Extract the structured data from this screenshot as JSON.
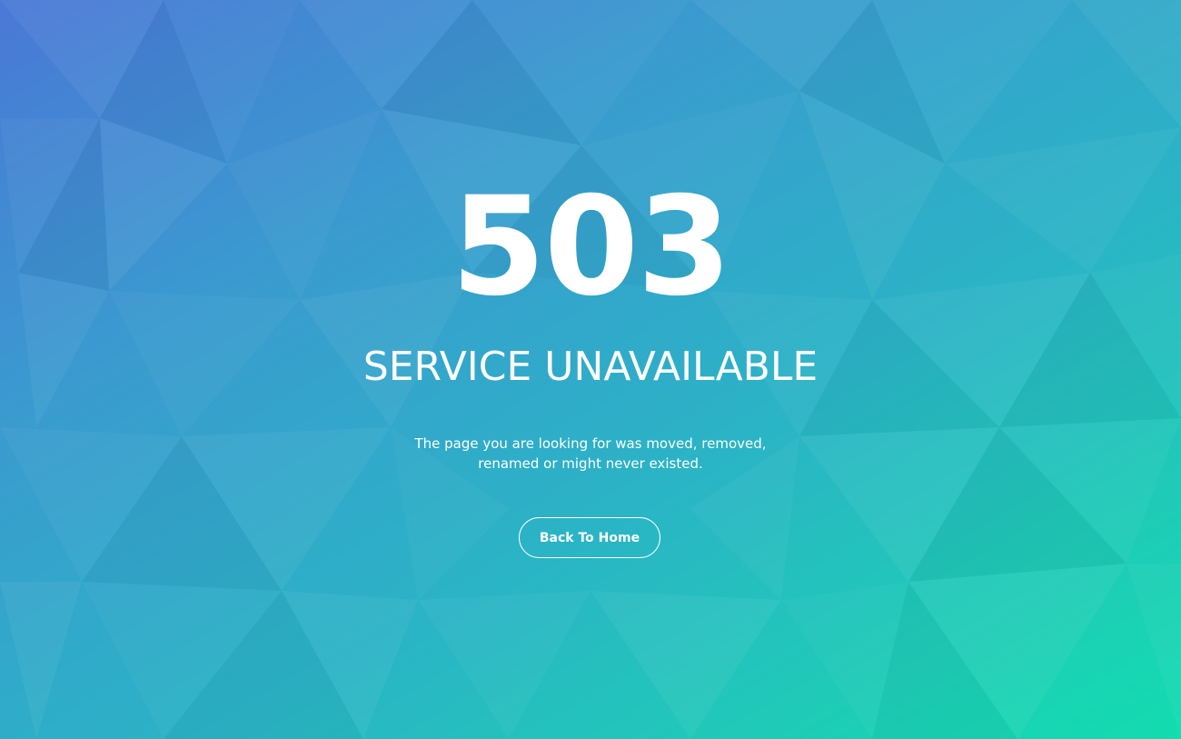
{
  "error": {
    "code": "503",
    "title": "SERVICE UNAVAILABLE",
    "message_line1": "The page you are looking for was moved, removed,",
    "message_line2": "renamed or might never existed."
  },
  "actions": {
    "back_home_label": "Back To Home"
  },
  "colors": {
    "gradient_start": "#4a78d6",
    "gradient_mid": "#2bb3c6",
    "gradient_end": "#12dcb0",
    "text": "#ffffff"
  }
}
